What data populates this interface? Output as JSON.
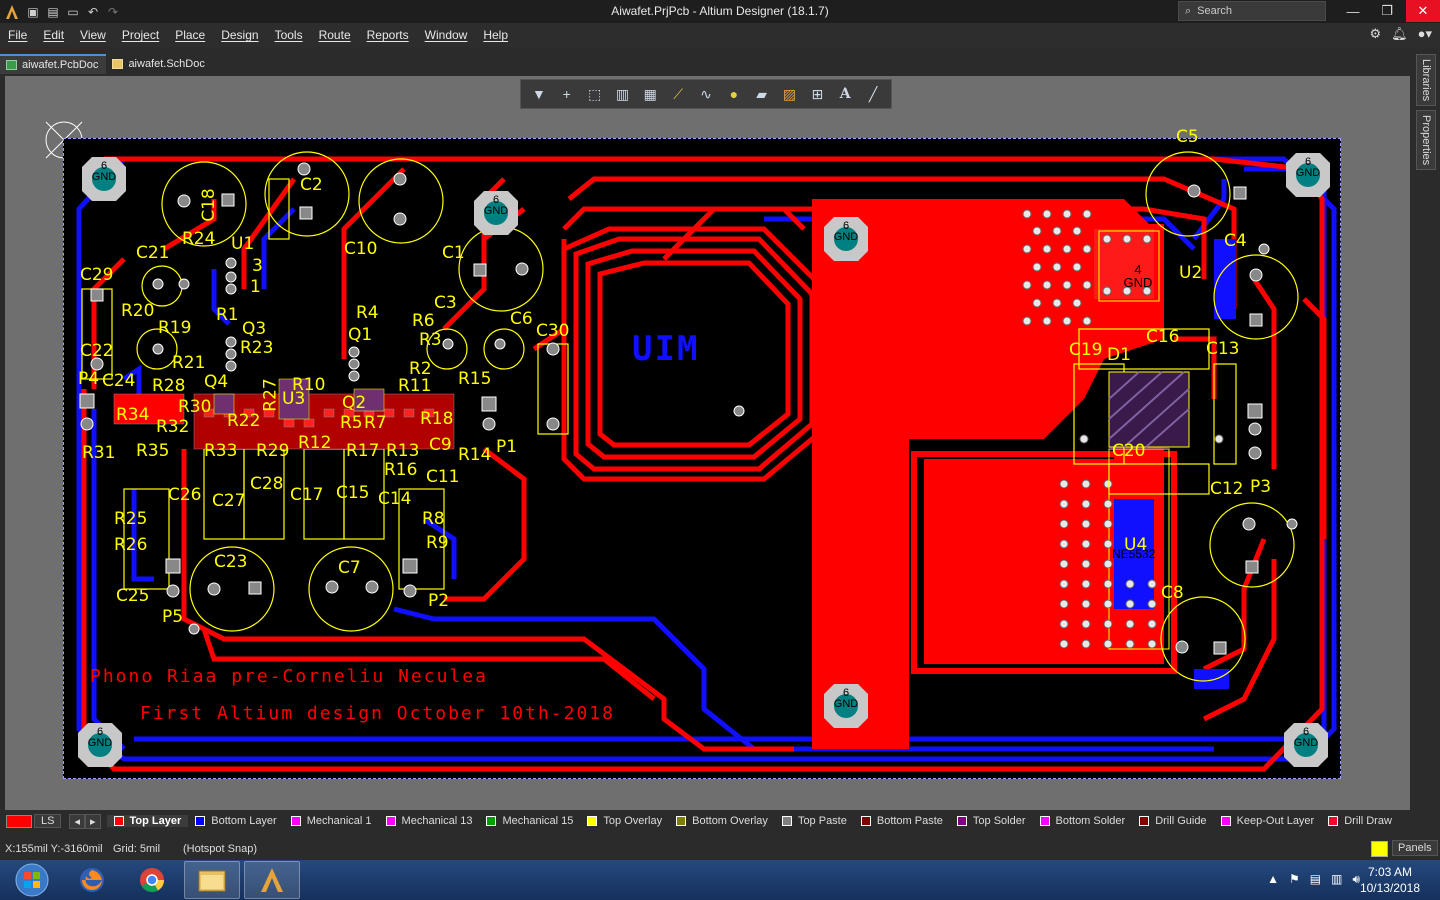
{
  "window": {
    "title": "Aiwafet.PrjPcb - Altium Designer (18.1.7)",
    "search_placeholder": "Search"
  },
  "menu": [
    "File",
    "Edit",
    "View",
    "Project",
    "Place",
    "Design",
    "Tools",
    "Route",
    "Reports",
    "Window",
    "Help"
  ],
  "tabs": [
    {
      "label": "aiwafet.PcbDoc",
      "active": true
    },
    {
      "label": "aiwafet.SchDoc",
      "active": false
    }
  ],
  "side_panels": [
    "Libraries",
    "Properties"
  ],
  "board": {
    "logo_text": "UIM",
    "line1": "Phono Riaa pre-Corneliu Neculea",
    "line2": "First  Altium design October 10th-2018",
    "gnd_pad": "GND",
    "gnd_num": "6",
    "u2_pad_num": "4",
    "u4_value": "NE5532",
    "designators": {
      "C5": "C5",
      "C4": "C4",
      "U2": "U2",
      "C16": "C16",
      "C19": "C19",
      "D1": "D1",
      "C13": "C13",
      "C20": "C20",
      "C12": "C12",
      "P3": "P3",
      "U4": "U4",
      "C8": "C8",
      "C18": "C18",
      "C2": "C2",
      "C10": "C10",
      "C1": "C1",
      "R24": "R24",
      "U1": "U1",
      "C21": "C21",
      "C29": "C29",
      "R20": "R20",
      "R19": "R19",
      "R1": "R1",
      "Q3": "Q3",
      "R23": "R23",
      "R21": "R21",
      "C22": "C22",
      "P4": "P4",
      "C24": "C24",
      "R28": "R28",
      "Q4": "Q4",
      "R27": "R27",
      "R10": "R10",
      "U3": "U3",
      "Q2": "Q2",
      "R11": "R11",
      "R34": "R34",
      "R30": "R30",
      "R22": "R22",
      "R32": "R32",
      "R31": "R31",
      "R35": "R35",
      "R33": "R33",
      "R29": "R29",
      "R12": "R12",
      "R5": "R5",
      "R7": "R7",
      "R17": "R17",
      "R13": "R13",
      "R16": "R16",
      "R18": "R18",
      "C9": "C9",
      "C11": "C11",
      "R14": "R14",
      "P1": "P1",
      "R4": "R4",
      "Q1": "Q1",
      "C3": "C3",
      "R6": "R6",
      "R3": "R3",
      "R2": "R2",
      "C6": "C6",
      "R15": "R15",
      "C30": "C30",
      "C26": "C26",
      "C27": "C27",
      "C28": "C28",
      "C17": "C17",
      "C15": "C15",
      "C14": "C14",
      "R8": "R8",
      "R9": "R9",
      "R25": "R25",
      "R26": "R26",
      "C25": "C25",
      "C23": "C23",
      "C7": "C7",
      "P5": "P5",
      "P2": "P2",
      "pin3": "3",
      "pin1": "1",
      "plus": "+"
    }
  },
  "layers": {
    "ls_label": "LS",
    "items": [
      {
        "label": "Top Layer",
        "color": "#ff0000",
        "active": true
      },
      {
        "label": "Bottom Layer",
        "color": "#0000ff",
        "active": false
      },
      {
        "label": "Mechanical 1",
        "color": "#ff00ff",
        "active": false
      },
      {
        "label": "Mechanical 13",
        "color": "#ff00ff",
        "active": false
      },
      {
        "label": "Mechanical 15",
        "color": "#00a000",
        "active": false
      },
      {
        "label": "Top Overlay",
        "color": "#ffff00",
        "active": false
      },
      {
        "label": "Bottom Overlay",
        "color": "#808000",
        "active": false
      },
      {
        "label": "Top Paste",
        "color": "#808080",
        "active": false
      },
      {
        "label": "Bottom Paste",
        "color": "#800000",
        "active": false
      },
      {
        "label": "Top Solder",
        "color": "#800080",
        "active": false
      },
      {
        "label": "Bottom Solder",
        "color": "#ff00ff",
        "active": false
      },
      {
        "label": "Drill Guide",
        "color": "#800000",
        "active": false
      },
      {
        "label": "Keep-Out Layer",
        "color": "#ff00ff",
        "active": false
      },
      {
        "label": "Drill Draw",
        "color": "#ff002a",
        "active": false
      }
    ]
  },
  "status": {
    "coords": "X:155mil Y:-3160mil",
    "grid": "Grid: 5mil",
    "snap": "(Hotspot Snap)",
    "panels": "Panels"
  },
  "taskbar": {
    "time": "7:03 AM",
    "date": "10/13/2018"
  }
}
